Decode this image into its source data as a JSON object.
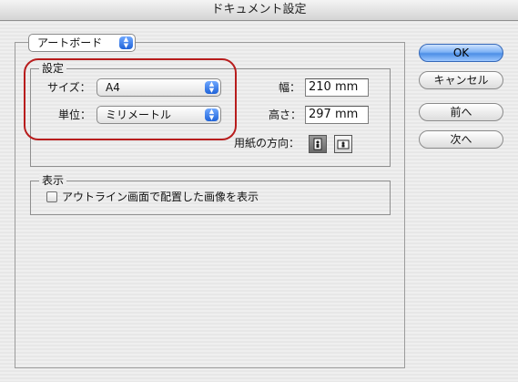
{
  "window": {
    "title": "ドキュメント設定"
  },
  "section_selector": {
    "value": "アートボード"
  },
  "settings_group": {
    "legend": "設定",
    "size_label": "サイズ：",
    "size_value": "A4",
    "unit_label": "単位：",
    "unit_value": "ミリメートル",
    "width_label": "幅：",
    "width_value": "210 mm",
    "height_label": "高さ：",
    "height_value": "297 mm",
    "orientation_label": "用紙の方向：",
    "orientation_selected": "portrait"
  },
  "display_group": {
    "legend": "表示",
    "checkbox_label": "アウトライン画面で配置した画像を表示",
    "checkbox_checked": false
  },
  "buttons": {
    "ok": "OK",
    "cancel": "キャンセル",
    "prev": "前へ",
    "next": "次へ"
  },
  "colors": {
    "highlight": "#b81d1d",
    "default_button": "#4d8fe6",
    "popup_arrow": "#1f63d8"
  }
}
